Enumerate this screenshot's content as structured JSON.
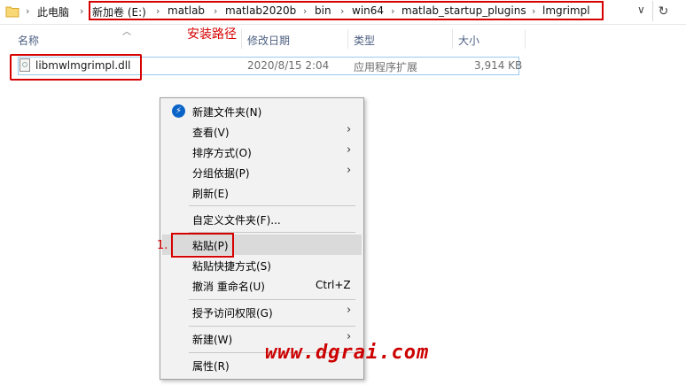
{
  "address_bar": {
    "breadcrumbs": [
      "此电脑",
      "新加卷 (E:)",
      "matlab",
      "matlab2020b",
      "bin",
      "win64",
      "matlab_startup_plugins",
      "lmgrimpl"
    ],
    "separator": "›",
    "dropdown_glyph": "∨",
    "refresh_glyph": "↻"
  },
  "columns": {
    "name": "名称",
    "modified": "修改日期",
    "type": "类型",
    "size": "大小"
  },
  "annotation_install_path": "安装路径",
  "file": {
    "name": "libmwlmgrimpl.dll",
    "modified": "2020/8/15 2:04",
    "type": "应用程序扩展",
    "size": "3,914 KB"
  },
  "context_menu": {
    "items": [
      {
        "label": "新建文件夹(N)",
        "icon": "new-folder-icon"
      },
      {
        "label": "查看(V)",
        "submenu": true
      },
      {
        "label": "排序方式(O)",
        "submenu": true
      },
      {
        "label": "分组依据(P)",
        "submenu": true
      },
      {
        "label": "刷新(E)"
      },
      {
        "label": "自定义文件夹(F)..."
      },
      {
        "label": "粘贴(P)",
        "highlighted": true
      },
      {
        "label": "粘贴快捷方式(S)"
      },
      {
        "label": "撤消 重命名(U)",
        "shortcut": "Ctrl+Z"
      },
      {
        "label": "授予访问权限(G)",
        "submenu": true
      },
      {
        "label": "新建(W)",
        "submenu": true
      },
      {
        "label": "属性(R)"
      }
    ],
    "submenu_arrow": "›"
  },
  "annotation_step": "1.",
  "watermark": "www.dgrai.com",
  "colors": {
    "annotation_red": "#d60000",
    "selection_border": "#99c9ef",
    "menu_bg": "#f2f2f2",
    "header_text": "#4d6082"
  }
}
